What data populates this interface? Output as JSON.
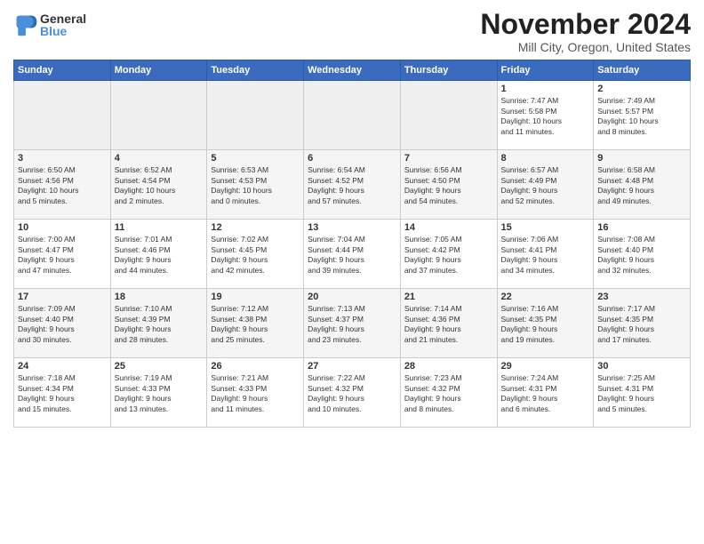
{
  "header": {
    "logo_general": "General",
    "logo_blue": "Blue",
    "month_title": "November 2024",
    "location": "Mill City, Oregon, United States"
  },
  "weekdays": [
    "Sunday",
    "Monday",
    "Tuesday",
    "Wednesday",
    "Thursday",
    "Friday",
    "Saturday"
  ],
  "weeks": [
    [
      {
        "day": "",
        "info": ""
      },
      {
        "day": "",
        "info": ""
      },
      {
        "day": "",
        "info": ""
      },
      {
        "day": "",
        "info": ""
      },
      {
        "day": "",
        "info": ""
      },
      {
        "day": "1",
        "info": "Sunrise: 7:47 AM\nSunset: 5:58 PM\nDaylight: 10 hours\nand 11 minutes."
      },
      {
        "day": "2",
        "info": "Sunrise: 7:49 AM\nSunset: 5:57 PM\nDaylight: 10 hours\nand 8 minutes."
      }
    ],
    [
      {
        "day": "3",
        "info": "Sunrise: 6:50 AM\nSunset: 4:56 PM\nDaylight: 10 hours\nand 5 minutes."
      },
      {
        "day": "4",
        "info": "Sunrise: 6:52 AM\nSunset: 4:54 PM\nDaylight: 10 hours\nand 2 minutes."
      },
      {
        "day": "5",
        "info": "Sunrise: 6:53 AM\nSunset: 4:53 PM\nDaylight: 10 hours\nand 0 minutes."
      },
      {
        "day": "6",
        "info": "Sunrise: 6:54 AM\nSunset: 4:52 PM\nDaylight: 9 hours\nand 57 minutes."
      },
      {
        "day": "7",
        "info": "Sunrise: 6:56 AM\nSunset: 4:50 PM\nDaylight: 9 hours\nand 54 minutes."
      },
      {
        "day": "8",
        "info": "Sunrise: 6:57 AM\nSunset: 4:49 PM\nDaylight: 9 hours\nand 52 minutes."
      },
      {
        "day": "9",
        "info": "Sunrise: 6:58 AM\nSunset: 4:48 PM\nDaylight: 9 hours\nand 49 minutes."
      }
    ],
    [
      {
        "day": "10",
        "info": "Sunrise: 7:00 AM\nSunset: 4:47 PM\nDaylight: 9 hours\nand 47 minutes."
      },
      {
        "day": "11",
        "info": "Sunrise: 7:01 AM\nSunset: 4:46 PM\nDaylight: 9 hours\nand 44 minutes."
      },
      {
        "day": "12",
        "info": "Sunrise: 7:02 AM\nSunset: 4:45 PM\nDaylight: 9 hours\nand 42 minutes."
      },
      {
        "day": "13",
        "info": "Sunrise: 7:04 AM\nSunset: 4:44 PM\nDaylight: 9 hours\nand 39 minutes."
      },
      {
        "day": "14",
        "info": "Sunrise: 7:05 AM\nSunset: 4:42 PM\nDaylight: 9 hours\nand 37 minutes."
      },
      {
        "day": "15",
        "info": "Sunrise: 7:06 AM\nSunset: 4:41 PM\nDaylight: 9 hours\nand 34 minutes."
      },
      {
        "day": "16",
        "info": "Sunrise: 7:08 AM\nSunset: 4:40 PM\nDaylight: 9 hours\nand 32 minutes."
      }
    ],
    [
      {
        "day": "17",
        "info": "Sunrise: 7:09 AM\nSunset: 4:40 PM\nDaylight: 9 hours\nand 30 minutes."
      },
      {
        "day": "18",
        "info": "Sunrise: 7:10 AM\nSunset: 4:39 PM\nDaylight: 9 hours\nand 28 minutes."
      },
      {
        "day": "19",
        "info": "Sunrise: 7:12 AM\nSunset: 4:38 PM\nDaylight: 9 hours\nand 25 minutes."
      },
      {
        "day": "20",
        "info": "Sunrise: 7:13 AM\nSunset: 4:37 PM\nDaylight: 9 hours\nand 23 minutes."
      },
      {
        "day": "21",
        "info": "Sunrise: 7:14 AM\nSunset: 4:36 PM\nDaylight: 9 hours\nand 21 minutes."
      },
      {
        "day": "22",
        "info": "Sunrise: 7:16 AM\nSunset: 4:35 PM\nDaylight: 9 hours\nand 19 minutes."
      },
      {
        "day": "23",
        "info": "Sunrise: 7:17 AM\nSunset: 4:35 PM\nDaylight: 9 hours\nand 17 minutes."
      }
    ],
    [
      {
        "day": "24",
        "info": "Sunrise: 7:18 AM\nSunset: 4:34 PM\nDaylight: 9 hours\nand 15 minutes."
      },
      {
        "day": "25",
        "info": "Sunrise: 7:19 AM\nSunset: 4:33 PM\nDaylight: 9 hours\nand 13 minutes."
      },
      {
        "day": "26",
        "info": "Sunrise: 7:21 AM\nSunset: 4:33 PM\nDaylight: 9 hours\nand 11 minutes."
      },
      {
        "day": "27",
        "info": "Sunrise: 7:22 AM\nSunset: 4:32 PM\nDaylight: 9 hours\nand 10 minutes."
      },
      {
        "day": "28",
        "info": "Sunrise: 7:23 AM\nSunset: 4:32 PM\nDaylight: 9 hours\nand 8 minutes."
      },
      {
        "day": "29",
        "info": "Sunrise: 7:24 AM\nSunset: 4:31 PM\nDaylight: 9 hours\nand 6 minutes."
      },
      {
        "day": "30",
        "info": "Sunrise: 7:25 AM\nSunset: 4:31 PM\nDaylight: 9 hours\nand 5 minutes."
      }
    ]
  ]
}
